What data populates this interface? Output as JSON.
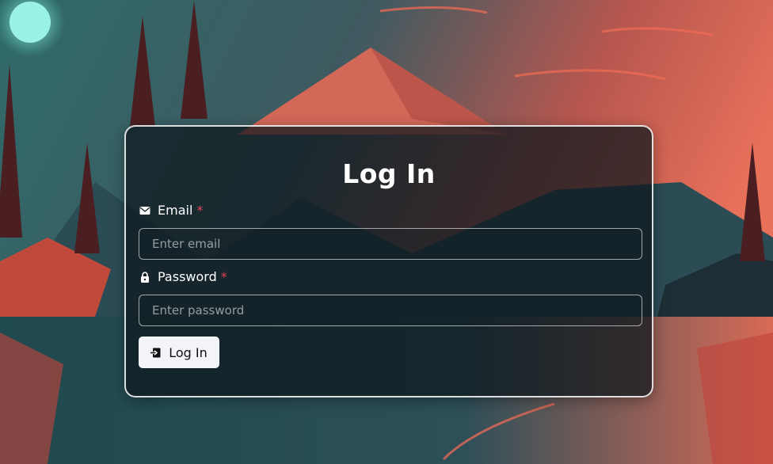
{
  "form": {
    "title": "Log In",
    "email": {
      "label": "Email",
      "required_mark": "*",
      "placeholder": "Enter email",
      "value": "",
      "icon": "envelope-icon"
    },
    "password": {
      "label": "Password",
      "required_mark": "*",
      "placeholder": "Enter password",
      "value": "",
      "icon": "lock-icon"
    },
    "submit": {
      "label": "Log In",
      "icon": "login-icon"
    }
  },
  "colors": {
    "required": "#e0455a",
    "button_bg": "#f3f4f8",
    "card_border": "#ffffff"
  }
}
